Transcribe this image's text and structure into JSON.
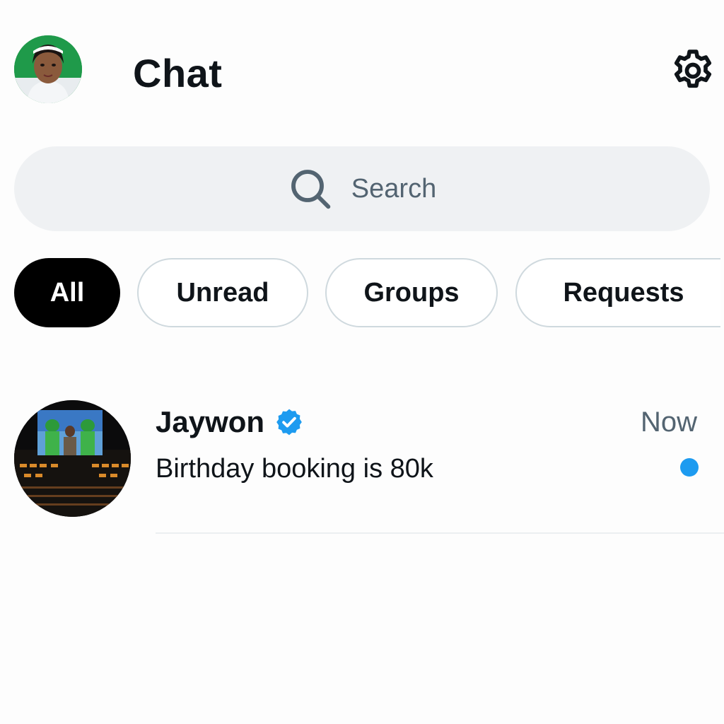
{
  "header": {
    "title": "Chat",
    "avatar_icon": "profile-avatar",
    "settings_icon": "gear-icon"
  },
  "search": {
    "placeholder": "Search",
    "icon": "search-icon"
  },
  "filters": [
    {
      "label": "All",
      "active": true
    },
    {
      "label": "Unread",
      "active": false
    },
    {
      "label": "Groups",
      "active": false
    },
    {
      "label": "Requests",
      "active": false
    }
  ],
  "conversations": [
    {
      "name": "Jaywon",
      "verified": true,
      "time": "Now",
      "preview": "Birthday booking is 80k",
      "unread": true
    }
  ],
  "colors": {
    "accent": "#1d9bf0",
    "active_chip": "#000000",
    "search_bg": "#eff1f3",
    "muted_text": "#536471"
  }
}
